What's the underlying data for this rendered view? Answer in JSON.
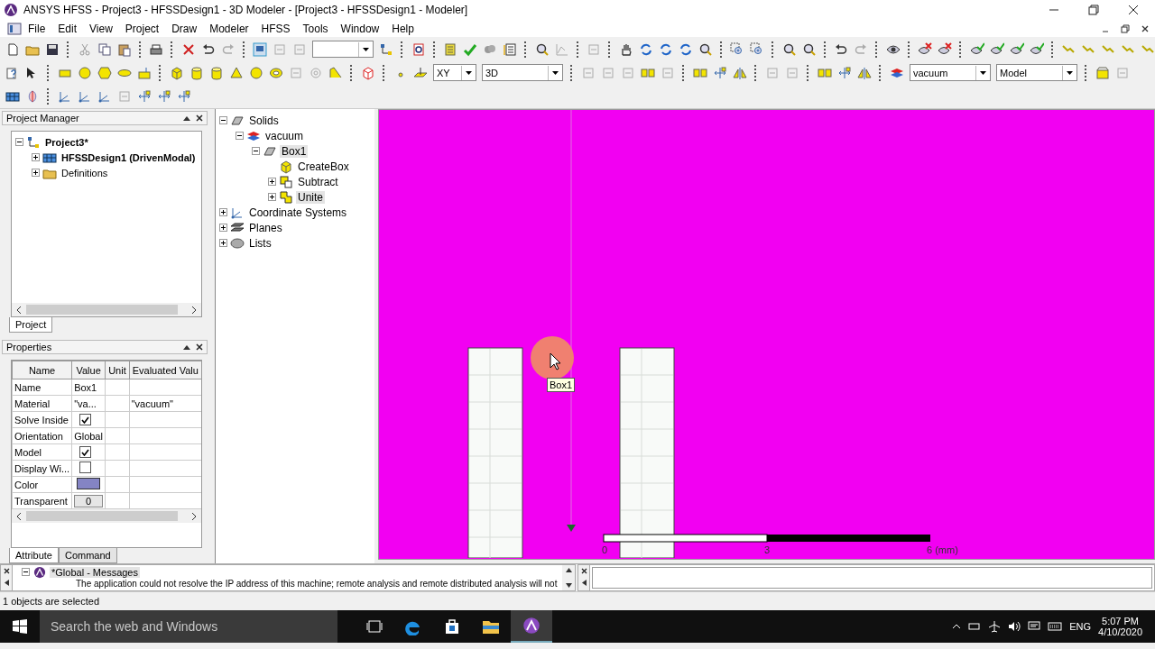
{
  "window": {
    "title": "ANSYS HFSS - Project3 - HFSSDesign1 - 3D Modeler - [Project3 - HFSSDesign1 - Modeler]"
  },
  "menu": [
    "File",
    "Edit",
    "View",
    "Project",
    "Draw",
    "Modeler",
    "HFSS",
    "Tools",
    "Window",
    "Help"
  ],
  "toolbar_dropdowns": [
    {
      "value": "XY"
    },
    {
      "value": "3D"
    },
    {
      "value": "vacuum"
    },
    {
      "value": "Model"
    }
  ],
  "project_manager": {
    "title": "Project Manager",
    "tree": [
      {
        "label": "Project3*",
        "kind": "project",
        "bold": true,
        "selected": false,
        "expanded": true,
        "children": [
          {
            "label": "HFSSDesign1 (DrivenModal)",
            "kind": "design",
            "bold": true,
            "selected": false,
            "expanded": false
          },
          {
            "label": "Definitions",
            "kind": "folder",
            "bold": false,
            "selected": false,
            "expanded": false
          }
        ]
      }
    ],
    "tabs": [
      {
        "label": "Project",
        "selected": true
      }
    ]
  },
  "properties": {
    "title": "Properties",
    "columns": [
      "Name",
      "Value",
      "Unit",
      "Evaluated Valu"
    ],
    "rows": [
      {
        "name": "Name",
        "kind": "text",
        "value": "Box1"
      },
      {
        "name": "Material",
        "kind": "text",
        "value": "\"va...",
        "evaluated": "\"vacuum\""
      },
      {
        "name": "Solve Inside",
        "kind": "checkbox",
        "checked": true
      },
      {
        "name": "Orientation",
        "kind": "text",
        "value": "Global"
      },
      {
        "name": "Model",
        "kind": "checkbox",
        "checked": true
      },
      {
        "name": "Display Wi...",
        "kind": "checkbox",
        "checked": false
      },
      {
        "name": "Color",
        "kind": "color",
        "color": "#8484c4"
      },
      {
        "name": "Transparent",
        "kind": "button",
        "value": "0"
      }
    ],
    "tabs": [
      {
        "label": "Attribute",
        "selected": true
      },
      {
        "label": "Command",
        "selected": false
      }
    ]
  },
  "model_tree": [
    {
      "label": "Solids",
      "kind": "group",
      "selected": false,
      "expanded": true,
      "children": [
        {
          "label": "vacuum",
          "kind": "material",
          "selected": false,
          "expanded": true,
          "children": [
            {
              "label": "Box1",
              "kind": "object",
              "selected": true,
              "expanded": true,
              "children": [
                {
                  "label": "CreateBox",
                  "kind": "create",
                  "selected": false
                },
                {
                  "label": "Subtract",
                  "kind": "subtract",
                  "selected": false,
                  "expanded": false
                },
                {
                  "label": "Unite",
                  "kind": "unite",
                  "selected": true,
                  "expanded": false
                }
              ]
            }
          ]
        }
      ]
    },
    {
      "label": "Coordinate Systems",
      "kind": "axes",
      "selected": false,
      "expanded": false
    },
    {
      "label": "Planes",
      "kind": "planes",
      "selected": false,
      "expanded": false
    },
    {
      "label": "Lists",
      "kind": "lists",
      "selected": false,
      "expanded": false
    }
  ],
  "viewport": {
    "tooltip": "Box1",
    "scale_labels": [
      "0",
      "3",
      "6 (mm)"
    ]
  },
  "messages": {
    "title": "*Global - Messages",
    "text": "The application could not resolve the IP address of this machine; remote analysis and remote distributed analysis will not"
  },
  "status_bar": "1 objects are selected",
  "taskbar": {
    "search": {
      "placeholder": "Search the web and Windows"
    },
    "language": "ENG",
    "time": "5:07 PM",
    "date": "4/10/2020"
  }
}
